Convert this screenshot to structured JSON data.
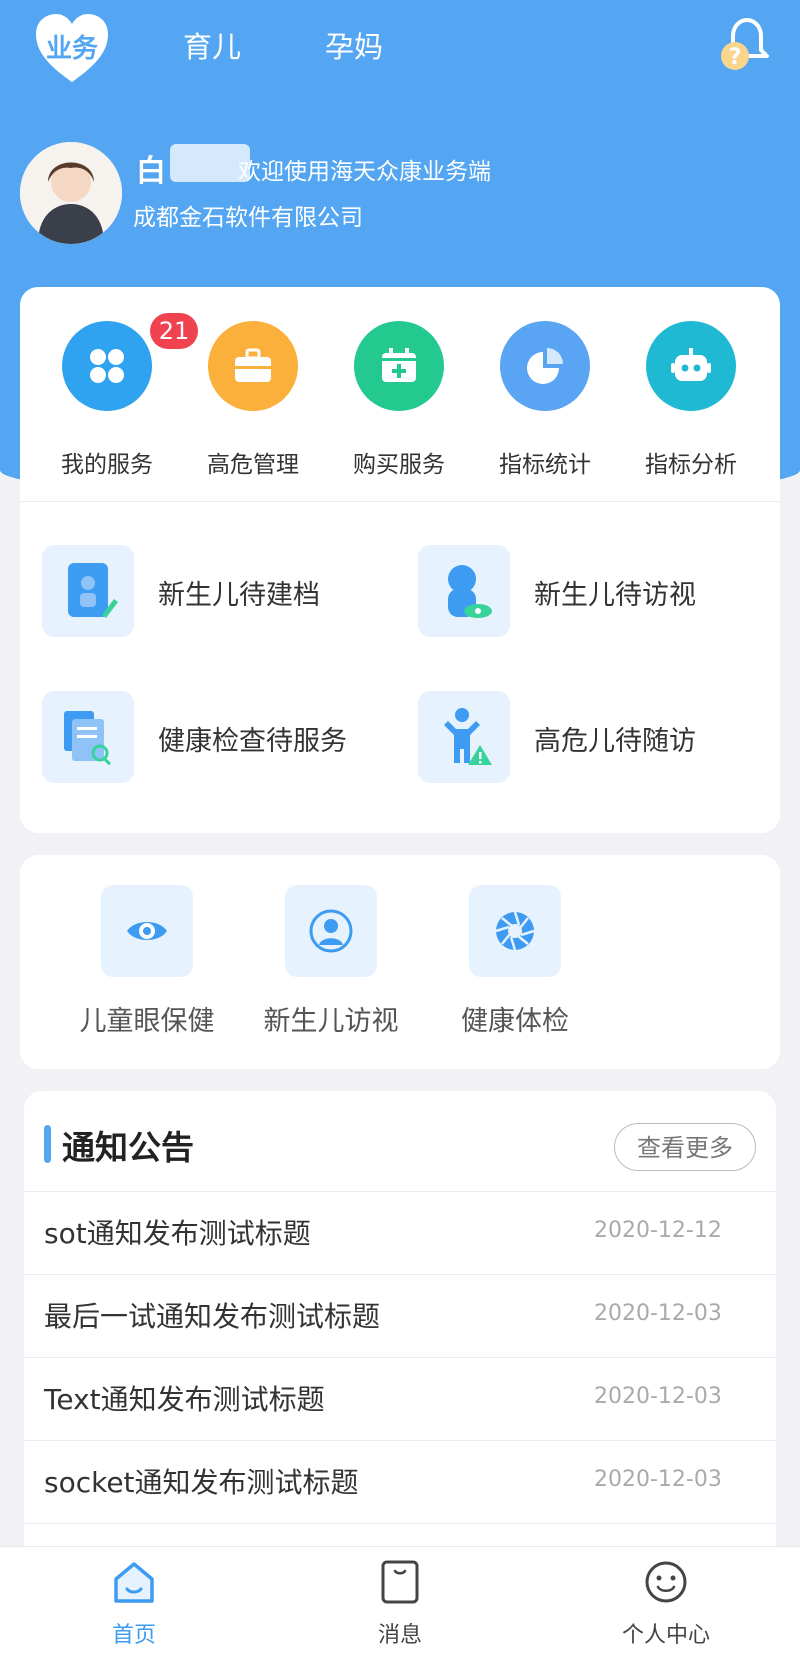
{
  "colors": {
    "primary": "#55a6f2",
    "badge": "#f0434f",
    "blue_icon": "#2fa3ef",
    "orange_icon": "#fbb03b",
    "green_icon": "#23c98f",
    "lightblue_icon": "#5aa4f4",
    "teal_icon": "#1fb9d4"
  },
  "header": {
    "logo_label": "业务",
    "tabs": [
      "育儿",
      "孕妈"
    ],
    "bell_icon": "bell-question-icon"
  },
  "user": {
    "name": "白",
    "welcome": "欢迎使用海天众康业务端",
    "company": "成都金石软件有限公司"
  },
  "services": [
    {
      "label": "我的服务",
      "icon": "clover-icon",
      "badge": "21"
    },
    {
      "label": "高危管理",
      "icon": "briefcase-icon"
    },
    {
      "label": "购买服务",
      "icon": "calendar-plus-icon"
    },
    {
      "label": "指标统计",
      "icon": "pie-chart-icon"
    },
    {
      "label": "指标分析",
      "icon": "robot-icon"
    }
  ],
  "tasks": [
    {
      "label": "新生儿待建档",
      "icon": "baby-record-icon"
    },
    {
      "label": "新生儿待访视",
      "icon": "baby-visit-icon"
    },
    {
      "label": "健康检查待服务",
      "icon": "document-search-icon"
    },
    {
      "label": "高危儿待随访",
      "icon": "child-warning-icon"
    }
  ],
  "items": [
    {
      "label": "儿童眼保健",
      "icon": "eye-icon"
    },
    {
      "label": "新生儿访视",
      "icon": "person-icon"
    },
    {
      "label": "健康体检",
      "icon": "aperture-icon"
    }
  ],
  "announcements": {
    "title": "通知公告",
    "more": "查看更多",
    "rows": [
      {
        "title": "sot通知发布测试标题",
        "date": "2020-12-12"
      },
      {
        "title": "最后一试通知发布测试标题",
        "date": "2020-12-03"
      },
      {
        "title": "Text通知发布测试标题",
        "date": "2020-12-03"
      },
      {
        "title": "socket通知发布测试标题",
        "date": "2020-12-03"
      }
    ]
  },
  "nav": [
    {
      "label": "首页",
      "icon": "home-icon",
      "active": true
    },
    {
      "label": "消息",
      "icon": "message-icon"
    },
    {
      "label": "个人中心",
      "icon": "smiley-icon"
    }
  ]
}
